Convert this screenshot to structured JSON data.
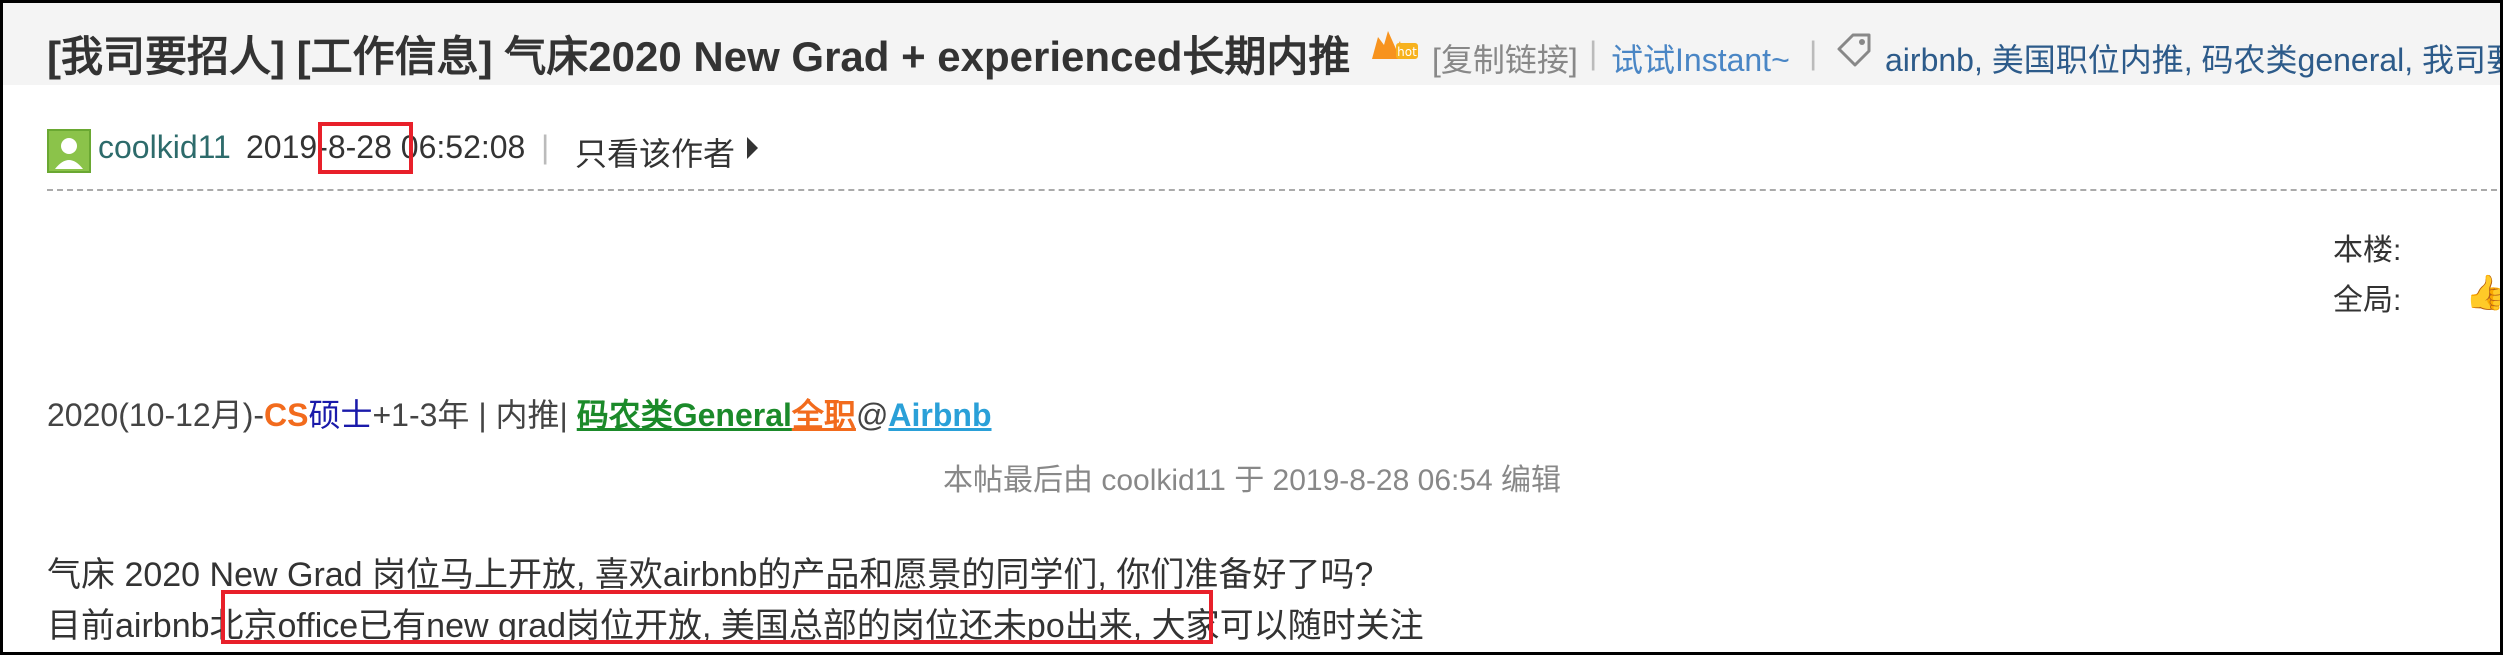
{
  "thread": {
    "title": "[我司要招人] [工作信息] 气床2020 New Grad + experienced长期内推",
    "copy_link": "[复制链接]",
    "sep1": "|",
    "instant": "试试Instant~",
    "sep2": "|",
    "tags": "airbnb, 美国职位内推, 码农类general, 我司要招"
  },
  "post": {
    "author": "coolkid11",
    "date_year": "2019-",
    "date_month_day": "8-28",
    "date_time": " 06:52:08",
    "separator": "|",
    "only_author": "只看该作者",
    "floor_label": "本楼:",
    "global_label": "全局:",
    "job_line": {
      "prefix": "2020(10-12月)-",
      "cs": "CS",
      "degree": "硕士",
      "rest": "+1-3年 | 内推|",
      "category": "码农类General",
      "fulltime": "全职",
      "at": "@",
      "company": "Airbnb"
    },
    "edit_note": "本帖最后由 coolkid11 于 2019-8-28 06:54 编辑",
    "body_line1": "气床 2020 New Grad 岗位马上开放, 喜欢airbnb的产品和愿景的同学们, 你们准备好了吗?",
    "body_line2_pre": "目前airbnb",
    "body_line2_hl": "北京office已有new grad岗位开放, 美国总部的岗位还未po出来",
    "body_line2_post": ", 大家可以随时关注"
  },
  "icons": {
    "hot": "fire-hot-icon",
    "tag": "tag-icon",
    "avatar": "user-avatar-icon",
    "arrow": "triangle-right-icon",
    "thumb": "thumbs-up-icon"
  },
  "colors": {
    "highlight_box": "#e8202a",
    "link_blue": "#4a86c5",
    "cs_orange": "#f26b1d",
    "general_green": "#1b8a2a",
    "company_blue": "#2aa0d8"
  }
}
